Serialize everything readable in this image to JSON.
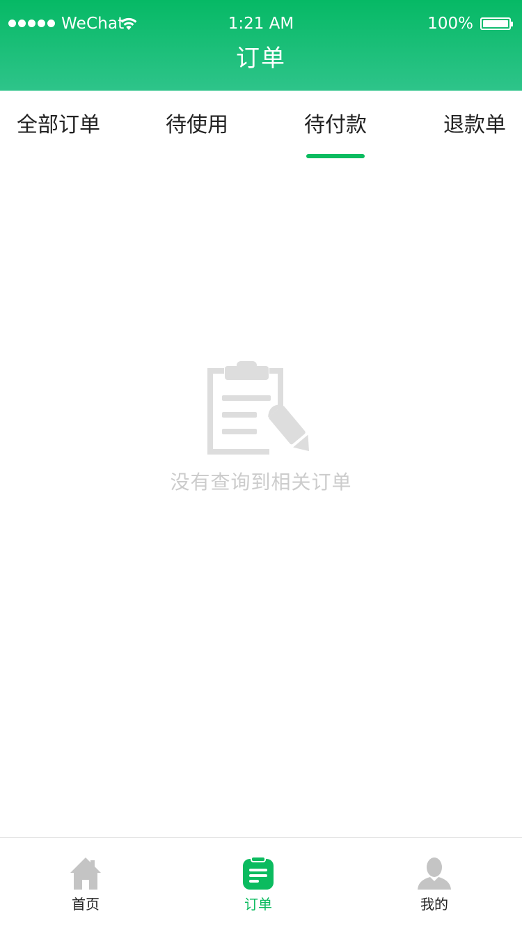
{
  "status_bar": {
    "carrier": "WeChat",
    "time": "1:21 AM",
    "battery": "100%"
  },
  "nav": {
    "title": "订单"
  },
  "tabs": [
    {
      "label": "全部订单",
      "active": false
    },
    {
      "label": "待使用",
      "active": false
    },
    {
      "label": "待付款",
      "active": true
    },
    {
      "label": "退款单",
      "active": false
    }
  ],
  "empty_state": {
    "icon": "clipboard-pencil-icon",
    "message": "没有查询到相关订单"
  },
  "tabbar": [
    {
      "label": "首页",
      "icon": "home-icon",
      "active": false
    },
    {
      "label": "订单",
      "icon": "orders-icon",
      "active": true
    },
    {
      "label": "我的",
      "icon": "user-icon",
      "active": false
    }
  ],
  "colors": {
    "brand_green": "#0bbb5f",
    "header_gradient_top": "#06b965",
    "header_gradient_bottom": "#2ec48a",
    "empty_gray": "#cccccc",
    "inactive_icon": "#c4c4c4"
  }
}
